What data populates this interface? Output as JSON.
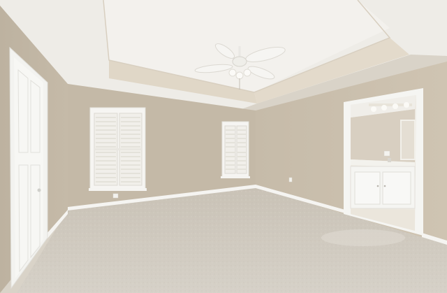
{
  "scene": {
    "subject": "empty-bedroom-interior",
    "elements": [
      "tray-ceiling",
      "ceiling-fan",
      "closet-door",
      "window-left",
      "window-right",
      "bathroom-doorway",
      "vanity",
      "carpet-floor"
    ]
  },
  "colors": {
    "wall": "#c7bcab",
    "wall_shadow": "#b6ab9a",
    "ceiling": "#f2f0ec",
    "tray_band": "#e2d9ca",
    "trim": "#f7f7f5",
    "carpet": "#cdc7bd",
    "shutter": "#f4f3ef",
    "bath_light": "#eeebe4"
  }
}
